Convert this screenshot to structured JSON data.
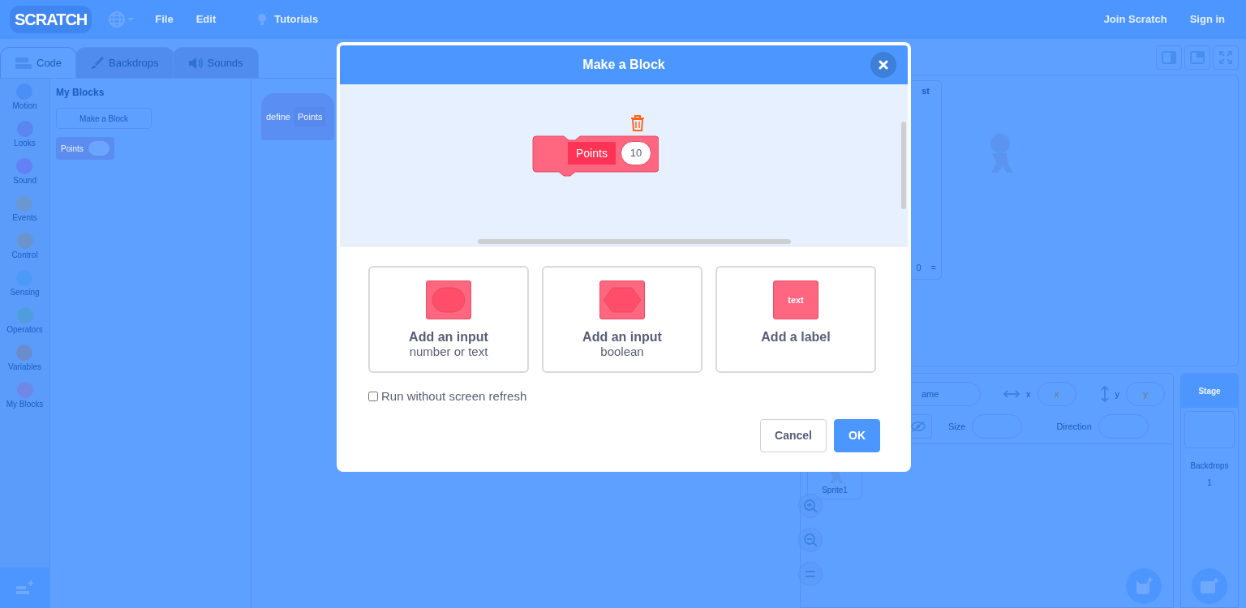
{
  "menu_bar": {
    "logo": "SCRATCH",
    "items": [
      {
        "label": "File",
        "kind": "plain"
      },
      {
        "label": "Edit",
        "kind": "plain"
      },
      {
        "label": "Tutorials",
        "kind": "bulb"
      }
    ],
    "account": [
      "Join Scratch",
      "Sign in"
    ]
  },
  "editor_tabs": [
    {
      "label": "Code",
      "kind": "code",
      "selected": true
    },
    {
      "label": "Backdrops",
      "kind": "brush",
      "selected": false
    },
    {
      "label": "Sounds",
      "kind": "speaker",
      "selected": false
    }
  ],
  "categories": [
    {
      "label": "Motion",
      "color": "#4a8ff8"
    },
    {
      "label": "Looks",
      "color": "#5a86f2"
    },
    {
      "label": "Sound",
      "color": "#6380f5"
    },
    {
      "label": "Events",
      "color": "#6a97d2"
    },
    {
      "label": "Control",
      "color": "#6a94cc"
    },
    {
      "label": "Sensing",
      "color": "#4c9af7"
    },
    {
      "label": "Operators",
      "color": "#4f9ddc"
    },
    {
      "label": "Variables",
      "color": "#6b8ccc"
    },
    {
      "label": "My Blocks",
      "color": "#6f88e6"
    }
  ],
  "palette": {
    "heading": "My Blocks",
    "make_block_button": "Make a Block",
    "block": {
      "label": "Points"
    }
  },
  "script_area": {
    "define_block": {
      "keyword": "define",
      "label": "Points"
    }
  },
  "list_monitor": {
    "title": "st",
    "length": "0",
    "resize": "="
  },
  "sprite_info": {
    "name_value": "ame",
    "x_label": "x",
    "x_placeholder": "x",
    "y_label": "y",
    "y_placeholder": "y",
    "size_label": "Size",
    "direction_label": "Direction"
  },
  "sprites": [
    {
      "name": "Sprite1"
    }
  ],
  "stage_pane": {
    "title": "Stage",
    "backdrops_label": "Backdrops",
    "backdrops_count": "1"
  },
  "modal": {
    "title": "Make a Block",
    "block": {
      "label": "Points",
      "input_value": "10"
    },
    "options": [
      {
        "kind": "round",
        "title": "Add an input",
        "subtitle": "number or text"
      },
      {
        "kind": "diamond",
        "title": "Add an input",
        "subtitle": "boolean"
      },
      {
        "kind": "label",
        "icon_text": "text",
        "title": "Add a label"
      }
    ],
    "run_without_refresh": {
      "label": "Run without screen refresh",
      "checked": false
    },
    "buttons": [
      {
        "label": "Cancel",
        "kind": "secondary"
      },
      {
        "label": "OK",
        "kind": "primary"
      }
    ]
  }
}
